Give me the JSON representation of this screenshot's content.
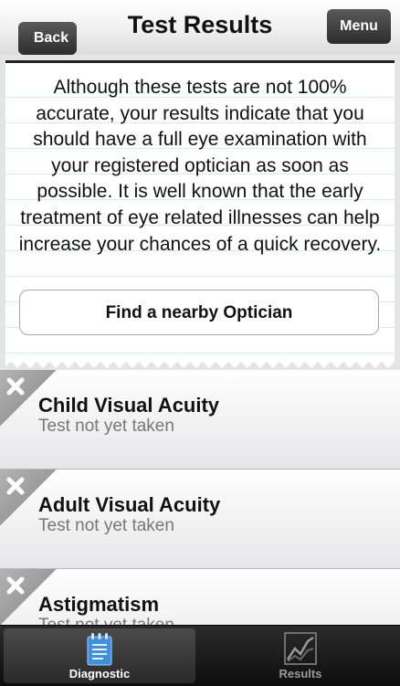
{
  "navbar": {
    "back_label": "Back",
    "title": "Test Results",
    "menu_label": "Menu"
  },
  "notice": {
    "text": "Although these tests are not 100% accurate, your results indicate that you should have a full eye examination with your registered optician as soon as possible. It is well known that the early treatment of eye related illnesses can help increase your chances of a quick recovery.",
    "button_label": "Find a nearby Optician"
  },
  "tests": [
    {
      "title": "Child Visual Acuity",
      "status": "Test not yet taken"
    },
    {
      "title": "Adult Visual Acuity",
      "status": "Test not yet taken"
    },
    {
      "title": "Astigmatism",
      "status": "Test not yet taken"
    }
  ],
  "tabbar": {
    "tabs": [
      {
        "label": "Diagnostic",
        "icon": "notepad-icon",
        "active": true,
        "color": "#ffffff"
      },
      {
        "label": "Results",
        "icon": "line-chart-icon",
        "active": false,
        "color": "#9a9a9a"
      }
    ]
  },
  "colors": {
    "accent_blue": "#3d8fe0",
    "status_text": "#777777"
  }
}
